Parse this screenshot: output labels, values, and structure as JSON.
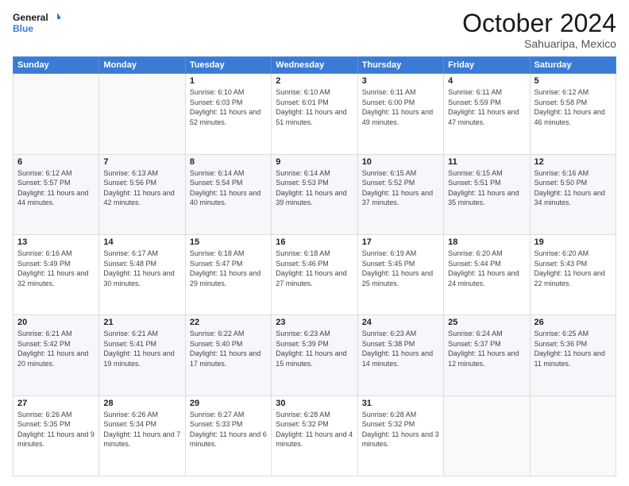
{
  "header": {
    "logo_line1": "General",
    "logo_line2": "Blue",
    "month_title": "October 2024",
    "subtitle": "Sahuaripa, Mexico"
  },
  "weekdays": [
    "Sunday",
    "Monday",
    "Tuesday",
    "Wednesday",
    "Thursday",
    "Friday",
    "Saturday"
  ],
  "weeks": [
    [
      {
        "day": "",
        "info": ""
      },
      {
        "day": "",
        "info": ""
      },
      {
        "day": "1",
        "info": "Sunrise: 6:10 AM\nSunset: 6:03 PM\nDaylight: 11 hours and 52 minutes."
      },
      {
        "day": "2",
        "info": "Sunrise: 6:10 AM\nSunset: 6:01 PM\nDaylight: 11 hours and 51 minutes."
      },
      {
        "day": "3",
        "info": "Sunrise: 6:11 AM\nSunset: 6:00 PM\nDaylight: 11 hours and 49 minutes."
      },
      {
        "day": "4",
        "info": "Sunrise: 6:11 AM\nSunset: 5:59 PM\nDaylight: 11 hours and 47 minutes."
      },
      {
        "day": "5",
        "info": "Sunrise: 6:12 AM\nSunset: 5:58 PM\nDaylight: 11 hours and 46 minutes."
      }
    ],
    [
      {
        "day": "6",
        "info": "Sunrise: 6:12 AM\nSunset: 5:57 PM\nDaylight: 11 hours and 44 minutes."
      },
      {
        "day": "7",
        "info": "Sunrise: 6:13 AM\nSunset: 5:56 PM\nDaylight: 11 hours and 42 minutes."
      },
      {
        "day": "8",
        "info": "Sunrise: 6:14 AM\nSunset: 5:54 PM\nDaylight: 11 hours and 40 minutes."
      },
      {
        "day": "9",
        "info": "Sunrise: 6:14 AM\nSunset: 5:53 PM\nDaylight: 11 hours and 39 minutes."
      },
      {
        "day": "10",
        "info": "Sunrise: 6:15 AM\nSunset: 5:52 PM\nDaylight: 11 hours and 37 minutes."
      },
      {
        "day": "11",
        "info": "Sunrise: 6:15 AM\nSunset: 5:51 PM\nDaylight: 11 hours and 35 minutes."
      },
      {
        "day": "12",
        "info": "Sunrise: 6:16 AM\nSunset: 5:50 PM\nDaylight: 11 hours and 34 minutes."
      }
    ],
    [
      {
        "day": "13",
        "info": "Sunrise: 6:16 AM\nSunset: 5:49 PM\nDaylight: 11 hours and 32 minutes."
      },
      {
        "day": "14",
        "info": "Sunrise: 6:17 AM\nSunset: 5:48 PM\nDaylight: 11 hours and 30 minutes."
      },
      {
        "day": "15",
        "info": "Sunrise: 6:18 AM\nSunset: 5:47 PM\nDaylight: 11 hours and 29 minutes."
      },
      {
        "day": "16",
        "info": "Sunrise: 6:18 AM\nSunset: 5:46 PM\nDaylight: 11 hours and 27 minutes."
      },
      {
        "day": "17",
        "info": "Sunrise: 6:19 AM\nSunset: 5:45 PM\nDaylight: 11 hours and 25 minutes."
      },
      {
        "day": "18",
        "info": "Sunrise: 6:20 AM\nSunset: 5:44 PM\nDaylight: 11 hours and 24 minutes."
      },
      {
        "day": "19",
        "info": "Sunrise: 6:20 AM\nSunset: 5:43 PM\nDaylight: 11 hours and 22 minutes."
      }
    ],
    [
      {
        "day": "20",
        "info": "Sunrise: 6:21 AM\nSunset: 5:42 PM\nDaylight: 11 hours and 20 minutes."
      },
      {
        "day": "21",
        "info": "Sunrise: 6:21 AM\nSunset: 5:41 PM\nDaylight: 11 hours and 19 minutes."
      },
      {
        "day": "22",
        "info": "Sunrise: 6:22 AM\nSunset: 5:40 PM\nDaylight: 11 hours and 17 minutes."
      },
      {
        "day": "23",
        "info": "Sunrise: 6:23 AM\nSunset: 5:39 PM\nDaylight: 11 hours and 15 minutes."
      },
      {
        "day": "24",
        "info": "Sunrise: 6:23 AM\nSunset: 5:38 PM\nDaylight: 11 hours and 14 minutes."
      },
      {
        "day": "25",
        "info": "Sunrise: 6:24 AM\nSunset: 5:37 PM\nDaylight: 11 hours and 12 minutes."
      },
      {
        "day": "26",
        "info": "Sunrise: 6:25 AM\nSunset: 5:36 PM\nDaylight: 11 hours and 11 minutes."
      }
    ],
    [
      {
        "day": "27",
        "info": "Sunrise: 6:26 AM\nSunset: 5:35 PM\nDaylight: 11 hours and 9 minutes."
      },
      {
        "day": "28",
        "info": "Sunrise: 6:26 AM\nSunset: 5:34 PM\nDaylight: 11 hours and 7 minutes."
      },
      {
        "day": "29",
        "info": "Sunrise: 6:27 AM\nSunset: 5:33 PM\nDaylight: 11 hours and 6 minutes."
      },
      {
        "day": "30",
        "info": "Sunrise: 6:28 AM\nSunset: 5:32 PM\nDaylight: 11 hours and 4 minutes."
      },
      {
        "day": "31",
        "info": "Sunrise: 6:28 AM\nSunset: 5:32 PM\nDaylight: 11 hours and 3 minutes."
      },
      {
        "day": "",
        "info": ""
      },
      {
        "day": "",
        "info": ""
      }
    ]
  ]
}
